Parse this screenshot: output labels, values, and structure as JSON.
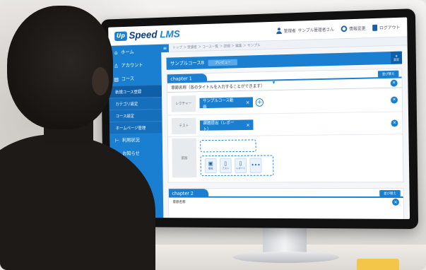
{
  "app": {
    "logo_mark": "Up",
    "logo_name": "Speed",
    "logo_suffix": "LMS"
  },
  "topbar": {
    "user_role": "管理者",
    "user_name": "サンプル管理者さん",
    "settings_label": "情報変更",
    "logout_label": "ログアウト"
  },
  "breadcrumb": "トップ ＞ 受講者 ＞ コース一覧 ＞ 詳細 ＞ 編集 ＞ サンプル",
  "sidebar": {
    "items": [
      {
        "glyph": "⌂",
        "label": "ホーム"
      },
      {
        "glyph": "♙",
        "label": "アカウント"
      },
      {
        "glyph": "▤",
        "label": "コース"
      }
    ],
    "subitems": [
      {
        "label": "新規コース登録"
      },
      {
        "label": "カテゴリ設定"
      },
      {
        "label": "コース設定"
      },
      {
        "label": "ホームページ管理"
      }
    ],
    "lower_items": [
      {
        "glyph": "⊢",
        "label": "利用状況"
      },
      {
        "glyph": "◎",
        "label": "お知らせ"
      }
    ]
  },
  "course": {
    "title": "サンプルコースB",
    "tag": "プレビュー",
    "button_label": "設定"
  },
  "chapter1": {
    "tab": "chapter 1",
    "button_label": "並び替え",
    "title_row": "章節名称（各のタイトルを入力することができます）",
    "rows": [
      {
        "label": "レクチャー",
        "pill": "サンプルコース動画"
      },
      {
        "label": "テスト",
        "pill": "課題提出（レポート）"
      }
    ],
    "add_label": "追加",
    "tools": [
      {
        "glyph": "▣",
        "label": "動画"
      },
      {
        "glyph": "▯",
        "label": "テスト"
      },
      {
        "glyph": "▯",
        "label": "レポート"
      },
      {
        "glyph": "•••",
        "label": ""
      }
    ]
  },
  "chapter2": {
    "tab": "chapter 2",
    "button_label": "並び替え",
    "title_row": "章節名称"
  }
}
